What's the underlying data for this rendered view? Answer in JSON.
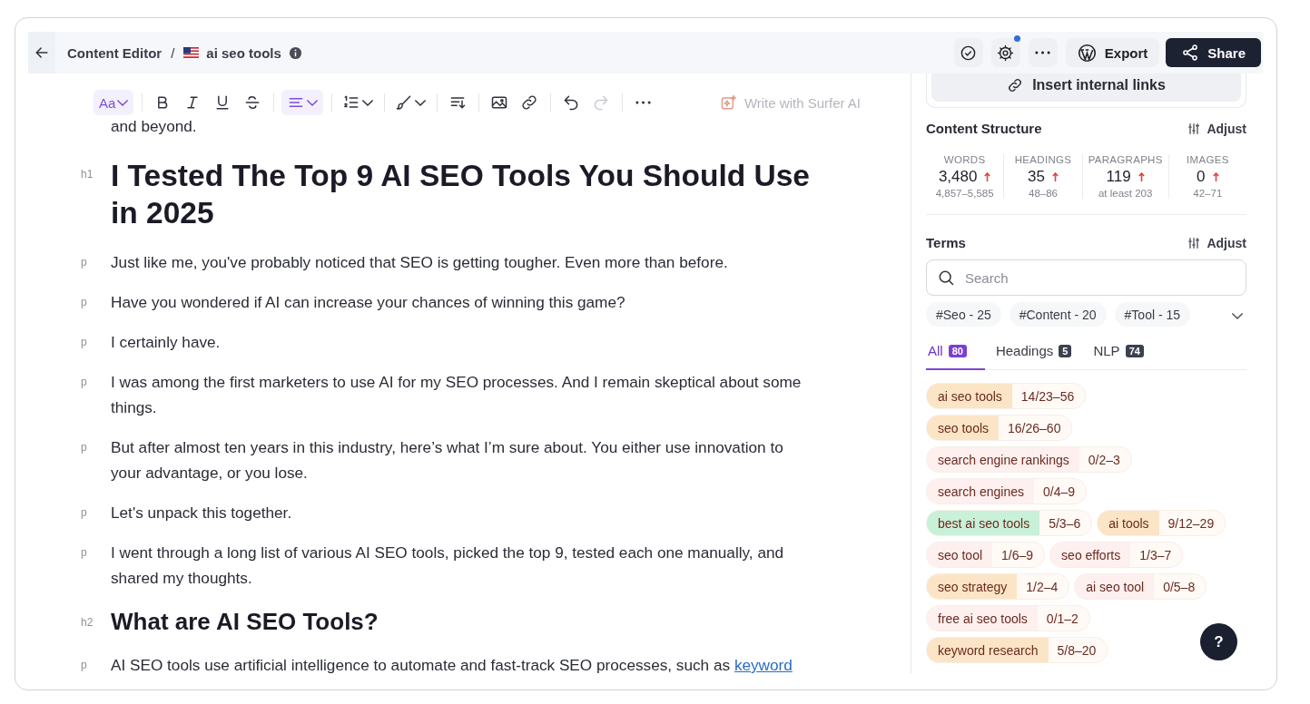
{
  "header": {
    "breadcrumb": "Content Editor",
    "separator": "/",
    "document": "ai seo tools",
    "notification": true,
    "export": "Export",
    "share": "Share"
  },
  "toolbar": [
    {
      "kind": "textstyle",
      "label": "Aa",
      "active": true,
      "disabled": false
    },
    {
      "kind": "bold",
      "active": false,
      "disabled": false
    },
    {
      "kind": "italic",
      "active": false,
      "disabled": false
    },
    {
      "kind": "underline",
      "active": false,
      "disabled": false
    },
    {
      "kind": "strike",
      "active": false,
      "disabled": false
    },
    {
      "kind": "align",
      "active": true,
      "disabled": false
    },
    {
      "kind": "list",
      "active": false,
      "disabled": false
    },
    {
      "kind": "brush",
      "active": false,
      "disabled": false
    },
    {
      "kind": "format",
      "active": false,
      "disabled": false
    },
    {
      "kind": "image",
      "active": false,
      "disabled": false
    },
    {
      "kind": "link",
      "active": false,
      "disabled": false
    },
    {
      "kind": "undo",
      "active": false,
      "disabled": false
    },
    {
      "kind": "redo",
      "active": false,
      "disabled": true
    },
    {
      "kind": "more",
      "active": false,
      "disabled": false
    }
  ],
  "ai_button": {
    "label": "Write with Surfer AI",
    "disabled": true
  },
  "document": [
    {
      "text": "and beyond."
    },
    {
      "tag": "h1",
      "text": "I Tested The Top 9 AI SEO Tools You Should Use in 2025"
    },
    {
      "tag": "p",
      "text": "Just like me, you've probably noticed that SEO is getting tougher. Even more than before."
    },
    {
      "tag": "p",
      "text": "Have you wondered if AI can increase your chances of winning this game?"
    },
    {
      "tag": "p",
      "text": "I certainly have."
    },
    {
      "tag": "p",
      "text": "I was among the first marketers to use AI for my SEO processes. And I remain skeptical about some things."
    },
    {
      "tag": "p",
      "text": "But after almost ten years in this industry, here’s what I’m sure about. You either use innovation to your advantage, or you lose."
    },
    {
      "tag": "p",
      "text": "Let's unpack this together."
    },
    {
      "tag": "p",
      "text": "I went through a long list of various AI SEO tools, picked the top 9, tested each one manually, and shared my thoughts."
    },
    {
      "tag": "h2",
      "text": "What are AI SEO Tools?"
    },
    {
      "tag": "p",
      "text": "AI SEO tools use artificial intelligence to automate and fast-track SEO processes, such as ",
      "link": "keyword "
    }
  ],
  "sidebar": {
    "insert_links": "Insert internal links",
    "structure": {
      "title": "Content Structure",
      "adjust": "Adjust",
      "stats": [
        {
          "label": "WORDS",
          "value": "3,480",
          "below_target": true,
          "range": "4,857–5,585"
        },
        {
          "label": "HEADINGS",
          "value": "35",
          "below_target": true,
          "range": "48–86"
        },
        {
          "label": "PARAGRAPHS",
          "value": "119",
          "below_target": true,
          "range": "at least 203"
        },
        {
          "label": "IMAGES",
          "value": "0",
          "below_target": true,
          "range": "42–71"
        }
      ]
    },
    "terms": {
      "title": "Terms",
      "adjust": "Adjust",
      "search": {
        "placeholder": "Search"
      },
      "filters": [
        "#Seo - 25",
        "#Content - 20",
        "#Tool - 15"
      ],
      "tabs": [
        {
          "label": "All",
          "count": "80",
          "selected": true
        },
        {
          "label": "Headings",
          "count": "5",
          "selected": false
        },
        {
          "label": "NLP",
          "count": "74",
          "selected": false
        }
      ],
      "items": [
        {
          "term": "ai seo tools",
          "count": "14/23–56",
          "color": "#fbe5c6"
        },
        {
          "term": "seo tools",
          "count": "16/26–60",
          "color": "#fbe5c6"
        },
        {
          "term": "search engine rankings",
          "count": "0/2–3",
          "color": "#fdf0ef"
        },
        {
          "term": "search engines",
          "count": "0/4–9",
          "color": "#fdf0ef"
        },
        {
          "term": "best ai seo tools",
          "count": "5/3–6",
          "color": "#c9f0d8"
        },
        {
          "term": "ai tools",
          "count": "9/12–29",
          "color": "#fbe5c6"
        },
        {
          "term": "seo tool",
          "count": "1/6–9",
          "color": "#fdf0ef"
        },
        {
          "term": "seo efforts",
          "count": "1/3–7",
          "color": "#fdf0ef"
        },
        {
          "term": "seo strategy",
          "count": "1/2–4",
          "color": "#fbe5c6"
        },
        {
          "term": "ai seo tool",
          "count": "0/5–8",
          "color": "#fdf0ef"
        },
        {
          "term": "free ai seo tools",
          "count": "0/1–2",
          "color": "#fdf0ef"
        },
        {
          "term": "keyword research",
          "count": "5/8–20",
          "color": "#fbe5c6"
        }
      ]
    }
  },
  "help": "?"
}
